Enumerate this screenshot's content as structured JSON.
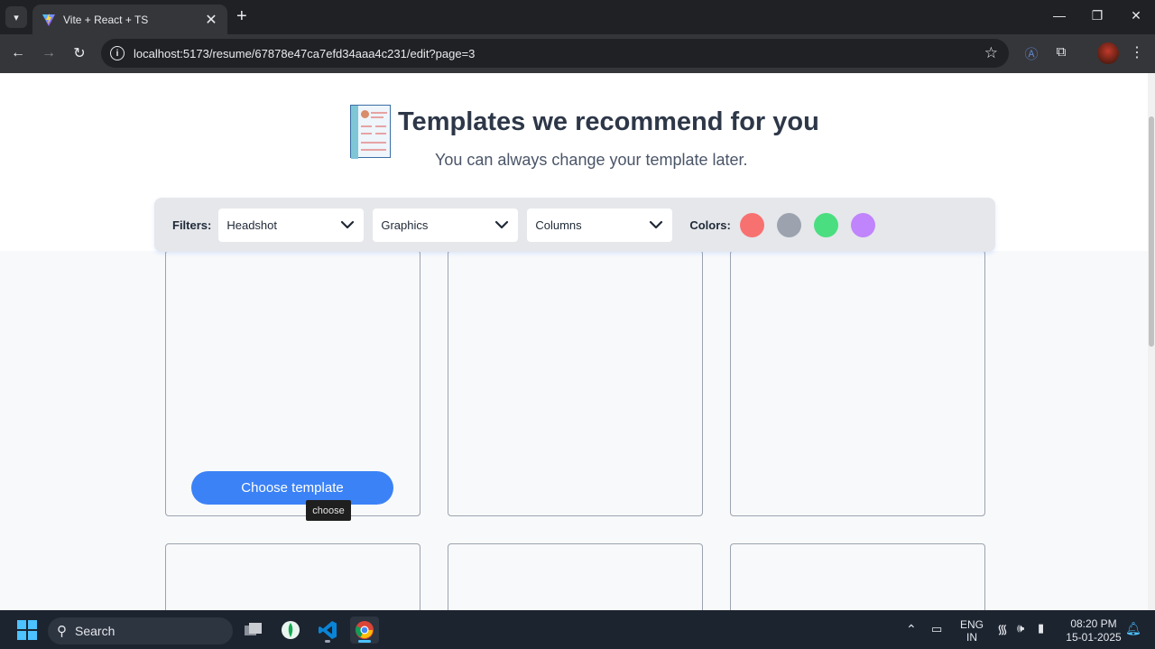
{
  "browser": {
    "tab_title": "Vite + React + TS",
    "new_tab_label": "+",
    "close_tab_label": "✕",
    "url": "localhost:5173/resume/67878e47ca7efd34aaa4c231/edit?page=3"
  },
  "page": {
    "title": "Templates we recommend for you",
    "subtitle": "You can always change your template later."
  },
  "filters": {
    "label": "Filters:",
    "selects": [
      {
        "value": "Headshot"
      },
      {
        "value": "Graphics"
      },
      {
        "value": "Columns"
      }
    ],
    "colors_label": "Colors:",
    "colors": [
      "#f87171",
      "#9ca3af",
      "#4ade80",
      "#c084fc"
    ]
  },
  "templates": {
    "choose_button_label": "Choose template",
    "tooltip": "choose"
  },
  "taskbar": {
    "search_label": "Search",
    "lang_top": "ENG",
    "lang_bottom": "IN",
    "time": "08:20 PM",
    "date": "15-01-2025"
  },
  "icons": [
    "tab-search-icon",
    "vite-favicon-icon",
    "back-icon",
    "forward-icon",
    "reload-icon",
    "site-info-icon",
    "bookmark-star-icon",
    "extension-icon",
    "profile-avatar",
    "menu-icon",
    "chevron-down-icon",
    "windows-start-icon",
    "search-icon",
    "task-view-icon",
    "mongodb-icon",
    "vscode-icon",
    "chrome-icon",
    "wifi-icon",
    "volume-icon",
    "battery-icon",
    "notification-bell-icon"
  ],
  "accent": "#3b82f6"
}
